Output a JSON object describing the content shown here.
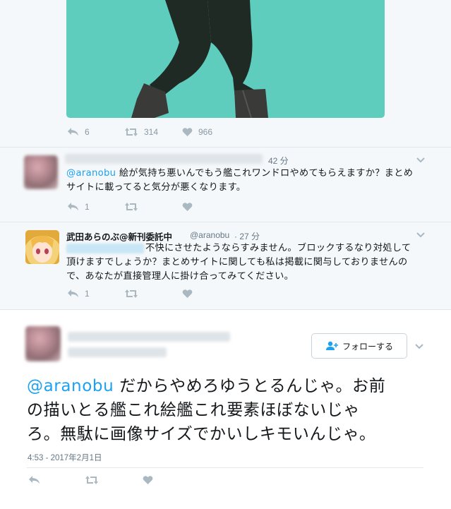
{
  "tweet1": {
    "replies": "6",
    "retweets": "314",
    "likes": "966"
  },
  "reply1": {
    "time": "42 分",
    "mention": "@aranobu",
    "text_line1": " 絵が気持ち悪いんでもう艦これワンドロやめてもらえますか？まとめ",
    "text_line2": "サイトに載ってると気分が悪くなります。",
    "replies": "1"
  },
  "reply2": {
    "author_name": "武田あらのぶ@新刊委託中",
    "handle": "@aranobu",
    "time": "· 27 分",
    "text_line1": "不快にさせたようならすみません。ブロックするなり対処して",
    "text_line2": "頂けますでしょうか？まとめサイトに関しても私は掲載に関与しておりませんの",
    "text_line3": "で、あなたが直接管理人に掛け合ってみてください。",
    "replies": "1"
  },
  "main_tweet": {
    "follow_label": "フォローする",
    "mention": "@aranobu",
    "text_line1": " だからやめろゆうとるんじゃ。お前",
    "text_line2": "の描いとる艦これ絵艦これ要素ほぼないじゃ",
    "text_line3": "ろ。無駄に画像サイズでかいしキモいんじゃ。",
    "timestamp": "4:53 - 2017年2月1日"
  },
  "colors": {
    "accent": "#1da1f2",
    "image_bg": "#5ecdbd",
    "muted": "#aab8c2"
  }
}
